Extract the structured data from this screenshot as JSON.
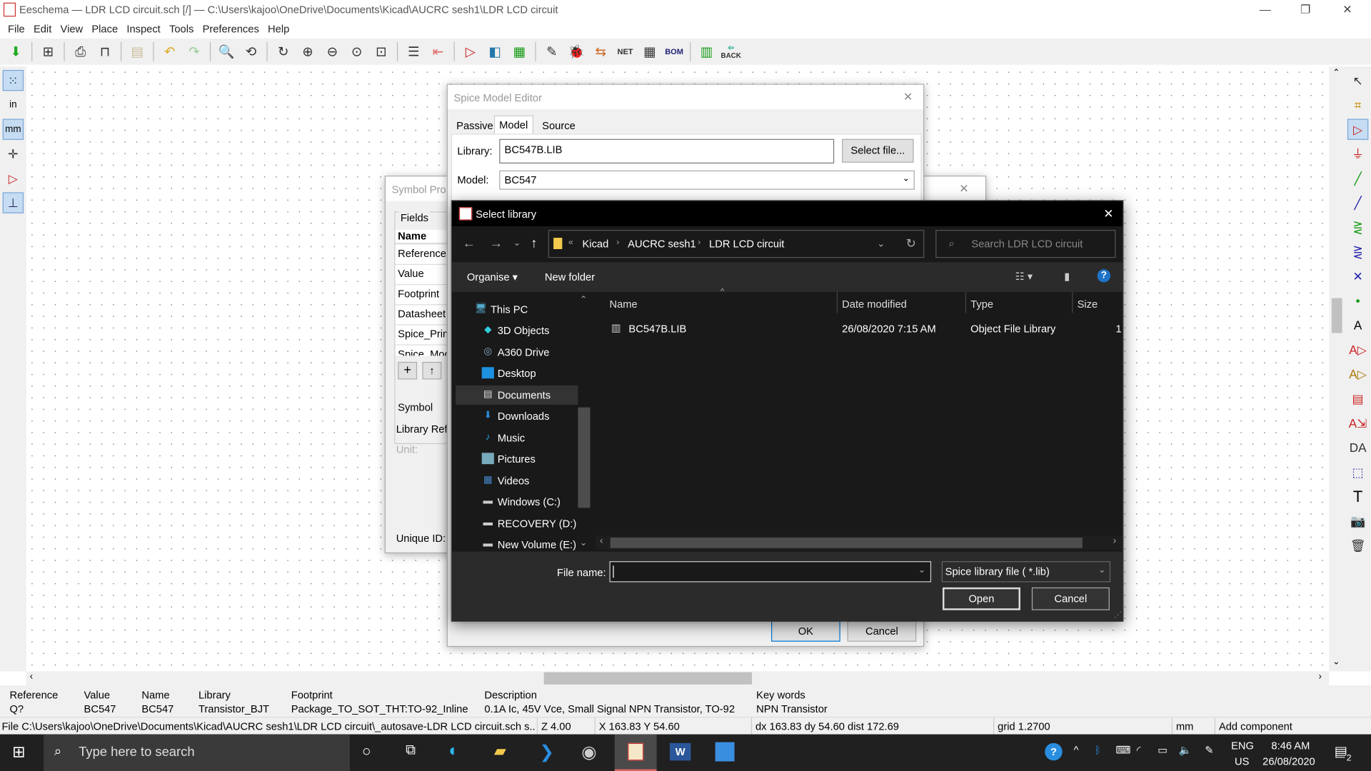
{
  "app": {
    "title": "Eeschema — LDR LCD circuit.sch [/] — C:\\Users\\kajoo\\OneDrive\\Documents\\Kicad\\AUCRC sesh1\\LDR LCD circuit",
    "menu": [
      "File",
      "Edit",
      "View",
      "Place",
      "Inspect",
      "Tools",
      "Preferences",
      "Help"
    ],
    "toolbar_icons": [
      "save-icon",
      "page-settings-icon",
      "print-icon",
      "plot-icon",
      "paste-icon",
      "undo-icon",
      "redo-icon",
      "find-icon",
      "find-replace-icon",
      "refresh-icon",
      "zoom-in-icon",
      "zoom-out-icon",
      "zoom-fit-icon",
      "zoom-selection-icon",
      "hierarchy-icon",
      "leave-sheet-icon",
      "symbol-editor-icon",
      "library-browser-icon",
      "footprint-editor-icon",
      "annotate-icon",
      "erc-icon",
      "assign-footprints-icon",
      "netlist-icon",
      "bom-table-icon",
      "bom-icon",
      "pcbnew-icon",
      "back-annotate-icon"
    ],
    "back_label": "BACK",
    "left_tools": {
      "in": "in",
      "mm": "mm"
    }
  },
  "spice_editor": {
    "title": "Spice Model Editor",
    "tabs": [
      "Passive",
      "Model",
      "Source"
    ],
    "active_tab": "Model",
    "library_label": "Library:",
    "library_value": "BC547B.LIB",
    "select_file": "Select file...",
    "model_label": "Model:",
    "model_value": "BC547",
    "ok": "OK",
    "cancel": "Cancel"
  },
  "symbol_props": {
    "title": "Symbol Pro",
    "fields_label": "Fields",
    "name_header": "Name",
    "rows": [
      "Reference",
      "Value",
      "Footprint",
      "Datasheet",
      "Spice_Prim",
      "Spice_Moc"
    ],
    "symbol_label": "Symbol",
    "library_ref": "Library Ref",
    "unit": "Unit:",
    "unique_id": "Unique ID:",
    "add": "+",
    "up": "↑"
  },
  "file_dialog": {
    "title": "Select library",
    "breadcrumb": [
      "Kicad",
      "AUCRC sesh1",
      "LDR LCD circuit"
    ],
    "search_placeholder": "Search LDR LCD circuit",
    "organise": "Organise",
    "new_folder": "New folder",
    "nav": [
      {
        "label": "This PC",
        "icon": "this-pc-icon"
      },
      {
        "label": "3D Objects",
        "icon": "3d-objects-icon"
      },
      {
        "label": "A360 Drive",
        "icon": "a360-drive-icon"
      },
      {
        "label": "Desktop",
        "icon": "desktop-icon"
      },
      {
        "label": "Documents",
        "icon": "documents-icon"
      },
      {
        "label": "Downloads",
        "icon": "downloads-icon"
      },
      {
        "label": "Music",
        "icon": "music-icon"
      },
      {
        "label": "Pictures",
        "icon": "pictures-icon"
      },
      {
        "label": "Videos",
        "icon": "videos-icon"
      },
      {
        "label": "Windows (C:)",
        "icon": "drive-icon"
      },
      {
        "label": "RECOVERY (D:)",
        "icon": "drive-icon"
      },
      {
        "label": "New Volume (E:)",
        "icon": "drive-icon"
      }
    ],
    "selected_nav": "Documents",
    "columns": [
      "Name",
      "Date modified",
      "Type",
      "Size"
    ],
    "files": [
      {
        "name": "BC547B.LIB",
        "date": "26/08/2020 7:15 AM",
        "type": "Object File Library",
        "size": "1"
      }
    ],
    "file_name_label": "File name:",
    "file_name_value": "",
    "filter": "Spice library file ( *.lib)",
    "open": "Open",
    "cancel": "Cancel"
  },
  "info_panel": {
    "headers": [
      "Reference",
      "Value",
      "Name",
      "Library",
      "Footprint",
      "Description",
      "Key words"
    ],
    "values": [
      "Q?",
      "BC547",
      "BC547",
      "Transistor_BJT",
      "Package_TO_SOT_THT:TO-92_Inline",
      "0.1A Ic, 45V Vce, Small Signal NPN Transistor, TO-92",
      "NPN Transistor"
    ]
  },
  "status": {
    "file": "File C:\\Users\\kajoo\\OneDrive\\Documents\\Kicad\\AUCRC sesh1\\LDR LCD circuit\\_autosave-LDR LCD circuit.sch s...",
    "zoom": "Z 4.00",
    "pos": "X 163.83  Y 54.60",
    "delta": "dx 163.83  dy 54.60  dist 172.69",
    "grid": "grid 1.2700",
    "units": "mm",
    "mode": "Add component"
  },
  "taskbar": {
    "search_placeholder": "Type here to search",
    "lang": "ENG",
    "region": "US",
    "time": "8:46 AM",
    "date": "26/08/2020",
    "notifications": "2"
  }
}
